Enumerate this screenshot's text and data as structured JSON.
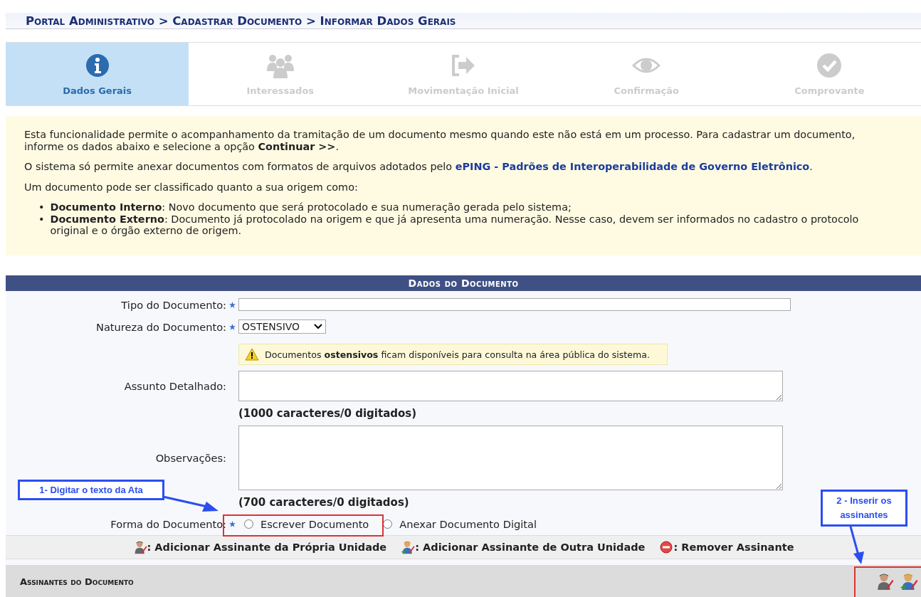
{
  "breadcrumb": "Portal Administrativo > Cadastrar Documento > Informar Dados Gerais",
  "steps": [
    {
      "label": "Dados Gerais",
      "kind": "info",
      "selected": true
    },
    {
      "label": "Interessados",
      "kind": "people",
      "selected": false
    },
    {
      "label": "Movimentação Inicial",
      "kind": "exit",
      "selected": false
    },
    {
      "label": "Confirmação",
      "kind": "eye",
      "selected": false
    },
    {
      "label": "Comprovante",
      "kind": "check",
      "selected": false
    }
  ],
  "info": {
    "paragraphs": [
      "Esta funcionalidade permite o acompanhamento da tramitação de um documento mesmo quando este não está em um processo. Para cadastrar um documento, informe os dados abaixo e selecione a opção **Continuar >>**."
    ],
    "link_intro": "O sistema só permite anexar documentos com formatos de arquivos adotados pelo",
    "link": "ePING - Padrões de Interoperabilidade de Governo Eletrônico",
    "link_end": ".",
    "list_intro": "Um documento pode ser classificado quanto a sua origem como:",
    "items": [
      {
        "bullet": "•",
        "text": "**Documento Interno**: Novo documento que será protocolado e sua numeração gerada pelo sistema;"
      },
      {
        "bullet": "•",
        "text": "**Documento Externo**: Documento já protocolado na origem e que já apresenta uma numeração. Nesse caso, devem ser informados no cadastro o protocolo original e o órgão externo de origem."
      }
    ]
  },
  "form": {
    "title": "Dados do Documento",
    "fields": [
      {
        "kind": "text",
        "label": "Tipo do Documento:",
        "required": true
      },
      {
        "kind": "select",
        "label": "Natureza do Documento:",
        "required": true,
        "value": "OSTENSIVO",
        "warning": "Documentos **ostensivos** ficam disponíveis para consulta na área pública do sistema."
      },
      {
        "kind": "textarea",
        "label": "Assunto Detalhado:",
        "required": false,
        "counter": "(1000 caracteres/0 digitados)"
      },
      {
        "kind": "textarea_tall",
        "label": "Observações:",
        "required": false,
        "counter": "(700 caracteres/0 digitados)"
      },
      {
        "kind": "radio",
        "label": "Forma do Documento:",
        "required": true,
        "options": [
          {
            "label": "Escrever Documento",
            "checked": false
          },
          {
            "label": "Anexar Documento Digital",
            "checked": false
          }
        ]
      }
    ]
  },
  "legend": [
    {
      "kind": "own",
      "text": ": Adicionar Assinante da Própria Unidade"
    },
    {
      "kind": "other",
      "text": ": Adicionar Assinante de Outra Unidade"
    },
    {
      "kind": "remove",
      "text": ": Remover Assinante"
    }
  ],
  "signers": {
    "title": "Assinantes do Documento"
  },
  "annotations": [
    {
      "kind": "form",
      "text": "1- Digitar o texto da Ata"
    },
    {
      "kind": "signers",
      "text": "2 - Inserir os assinantes"
    }
  ]
}
